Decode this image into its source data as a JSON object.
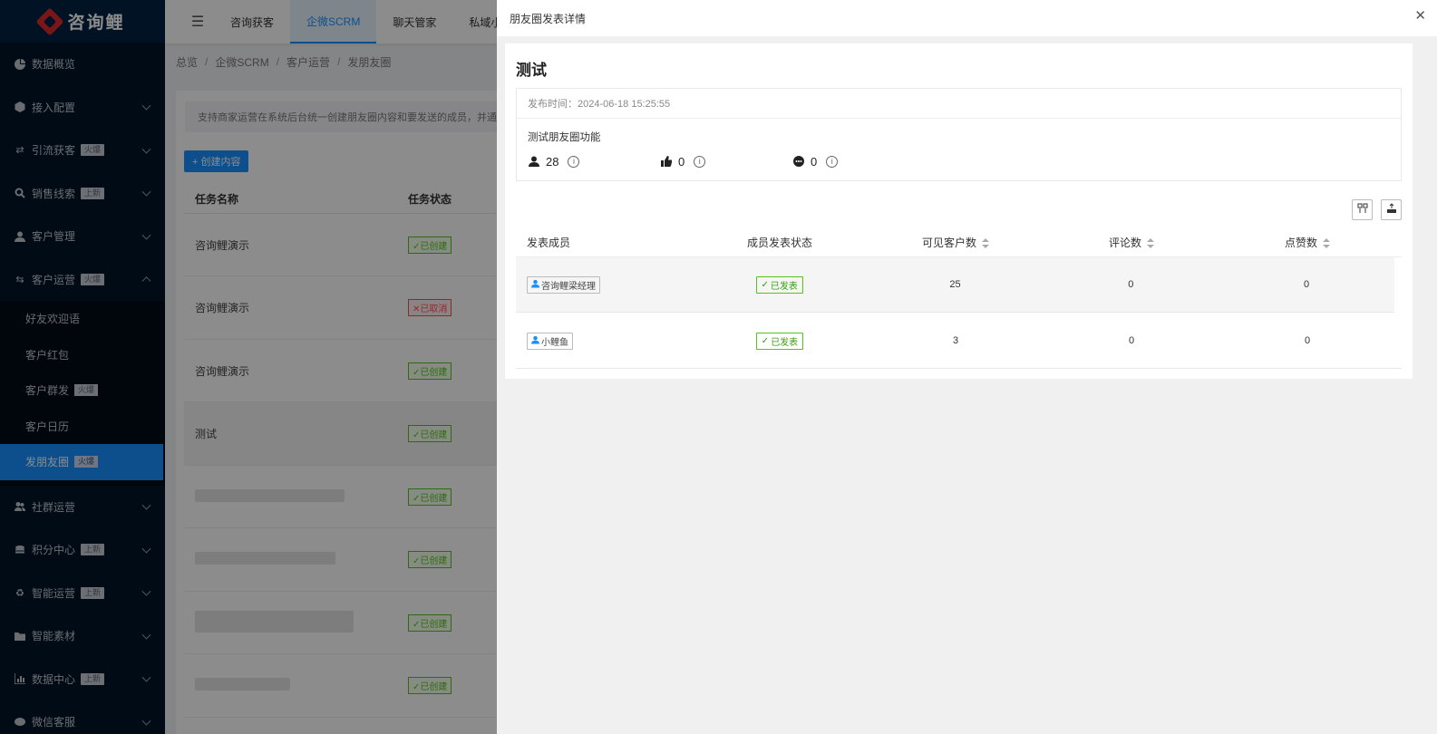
{
  "sidebar": {
    "logo_text": "咨询鲤",
    "items": [
      {
        "label": "数据概览",
        "icon": "pie-chart-icon"
      },
      {
        "label": "接入配置",
        "icon": "cube-icon"
      },
      {
        "label": "引流获客",
        "icon": "swap-icon",
        "badge": "火爆"
      },
      {
        "label": "销售线索",
        "icon": "search-icon",
        "badge": "上新"
      },
      {
        "label": "客户管理",
        "icon": "user-icon"
      },
      {
        "label": "客户运营",
        "icon": "retweet-icon",
        "badge": "火爆"
      }
    ],
    "submenu": [
      {
        "label": "好友欢迎语"
      },
      {
        "label": "客户红包"
      },
      {
        "label": "客户群发",
        "badge": "火爆"
      },
      {
        "label": "客户日历"
      },
      {
        "label": "发朋友圈",
        "badge": "火爆"
      }
    ],
    "items_after": [
      {
        "label": "社群运营",
        "icon": "team-icon"
      },
      {
        "label": "积分中心",
        "icon": "coins-icon",
        "badge": "上新"
      },
      {
        "label": "智能运营",
        "icon": "recycle-icon",
        "badge": "上新"
      },
      {
        "label": "智能素材",
        "icon": "folder-icon"
      },
      {
        "label": "数据中心",
        "icon": "bar-chart-icon",
        "badge": "上新"
      },
      {
        "label": "微信客服",
        "icon": "chat-icon"
      }
    ]
  },
  "topbar": {
    "tabs": [
      "咨询获客",
      "企微SCRM",
      "聊天管家",
      "私域小"
    ],
    "active_tab": "企微SCRM"
  },
  "breadcrumb": [
    "总览",
    "企微SCRM",
    "客户运营",
    "发朋友圈"
  ],
  "background_page": {
    "alert": "支持商家运营在系统后台统一创建朋友圈内容和要发送的成员，并通",
    "create_button": "+ 创建内容",
    "columns": [
      "任务名称",
      "任务状态"
    ],
    "rows": [
      {
        "name": "咨询鲤演示",
        "status": "✓已创建"
      },
      {
        "name": "咨询鲤演示",
        "status": "✕已取消"
      },
      {
        "name": "咨询鲤演示",
        "status": "✓已创建"
      },
      {
        "name": "测试",
        "status": "✓已创建"
      },
      {
        "name": "",
        "status": "✓已创建"
      },
      {
        "name": "",
        "status": "✓已创建"
      },
      {
        "name": "",
        "status": "✓已创建"
      },
      {
        "name": "",
        "status": "✓已创建"
      }
    ]
  },
  "drawer": {
    "title": "朋友圈发表详情",
    "post_title": "测试",
    "publish_time": "发布时间：2024-06-18 15:25:55",
    "content": "测试朋友圈功能",
    "stats": {
      "visible": "28",
      "likes": "0",
      "comments": "0"
    },
    "table": {
      "columns": [
        "发表成员",
        "成员发表状态",
        "可见客户数",
        "评论数",
        "点赞数"
      ],
      "rows": [
        {
          "member": "咨询鲤梁经理",
          "status": "已发表",
          "visible": "25",
          "comments": "0",
          "likes": "0"
        },
        {
          "member": "小鲤鱼",
          "status": "已发表",
          "visible": "3",
          "comments": "0",
          "likes": "0"
        }
      ]
    }
  }
}
